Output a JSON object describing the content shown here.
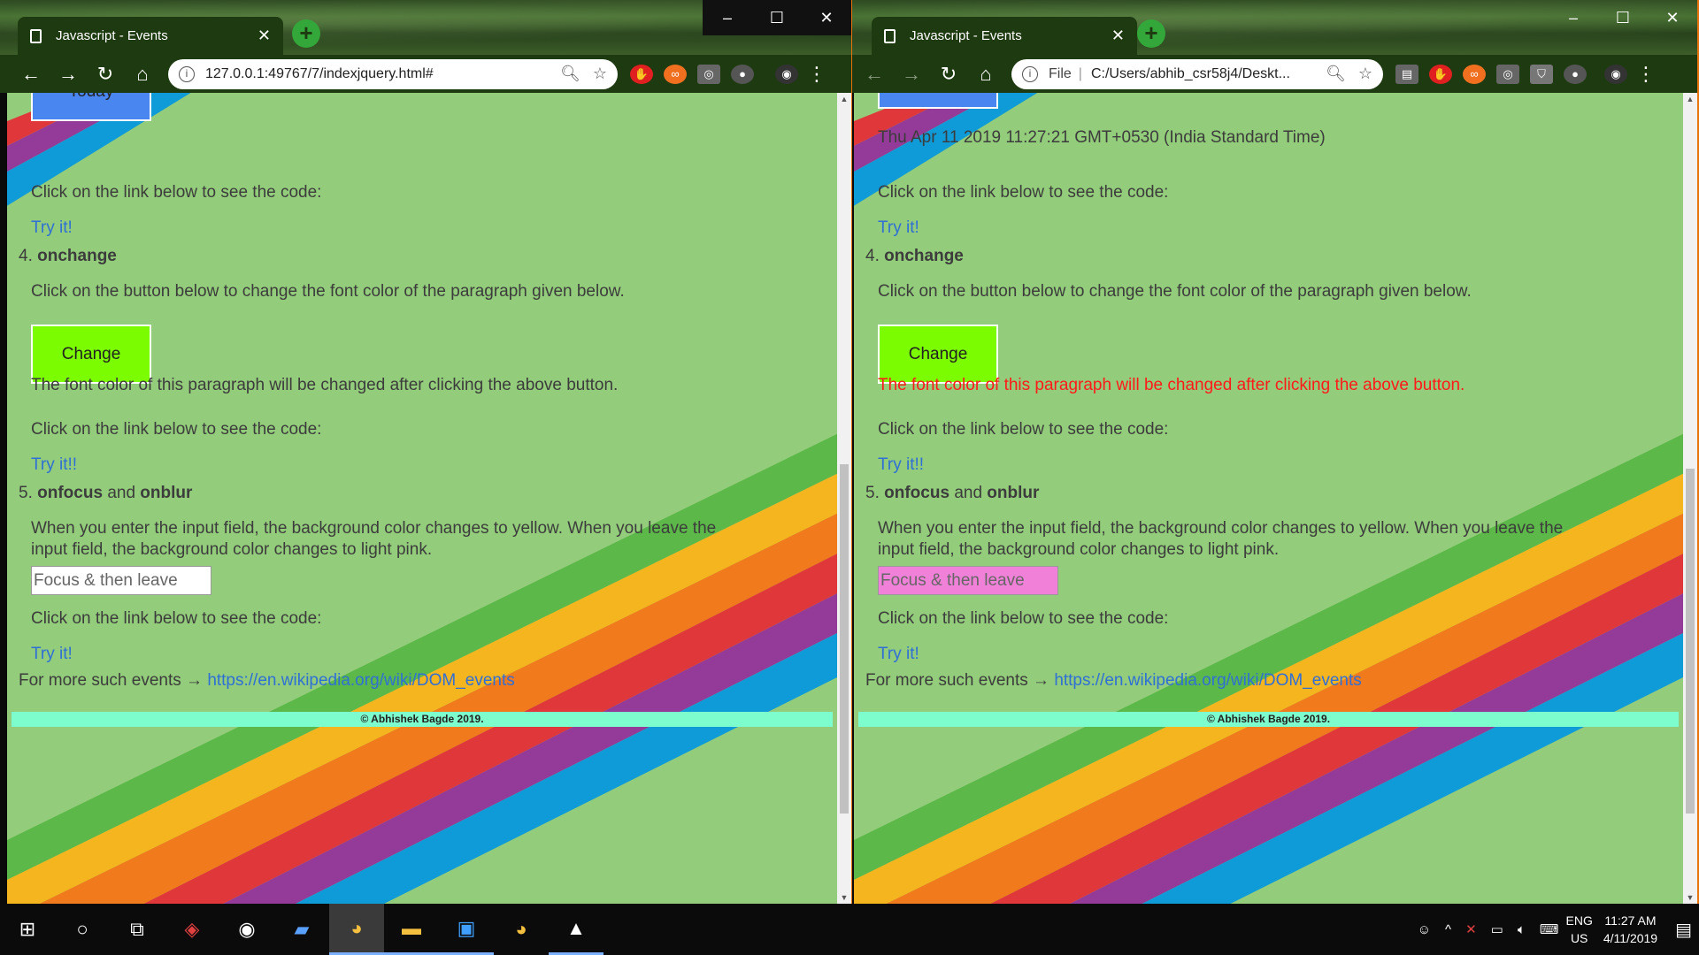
{
  "left_window": {
    "tab_title": "Javascript - Events",
    "url": "127.0.0.1:49767/7/indexjquery.html#",
    "today_button": "Today",
    "date_text": "",
    "click_link_text": "Click on the link below to see the code:",
    "try1": "Try it!",
    "h4_num": "4.",
    "h4_name": "onchange",
    "onchange_desc": "Click on the button below to change the font color of the paragraph given below.",
    "change_button": "Change",
    "para_text": "The font color of this paragraph will be changed after clicking the above button.",
    "para_color": "#3c3c3c",
    "click_link_text2": "Click on the link below to see the code:",
    "try2": "Try it!!",
    "h5_num": "5.",
    "h5_name1": "onfocus",
    "h5_and": "and",
    "h5_name2": "onblur",
    "focus_desc_1": "When you enter the input field, the background color changes to yellow. When you leave the",
    "focus_desc_2": "input field, the background color changes to light pink.",
    "input_value": "Focus & then leave",
    "input_bg": "#ffffff",
    "click_link_text3": "Click on the link below to see the code:",
    "try3": "Try it!",
    "more_events": "For more such events →",
    "more_link": "https://en.wikipedia.org/wiki/DOM_events",
    "footer": "© Abhishek Bagde 2019."
  },
  "right_window": {
    "tab_title": "Javascript - Events",
    "url_prefix": "File",
    "url": "C:/Users/abhib_csr58j4/Deskt...",
    "date_text": "Thu Apr 11 2019 11:27:21 GMT+0530 (India Standard Time)",
    "click_link_text": "Click on the link below to see the code:",
    "try1": "Try it!",
    "h4_num": "4.",
    "h4_name": "onchange",
    "onchange_desc": "Click on the button below to change the font color of the paragraph given below.",
    "change_button": "Change",
    "para_text": "The font color of this paragraph will be changed after clicking the above button.",
    "para_color": "#ff1a1a",
    "click_link_text2": "Click on the link below to see the code:",
    "try2": "Try it!!",
    "h5_num": "5.",
    "h5_name1": "onfocus",
    "h5_and": "and",
    "h5_name2": "onblur",
    "focus_desc_1": "When you enter the input field, the background color changes to yellow. When you leave the",
    "focus_desc_2": "input field, the background color changes to light pink.",
    "input_value": "Focus & then leave",
    "input_bg": "#f080d8",
    "click_link_text3": "Click on the link below to see the code:",
    "try3": "Try it!",
    "more_events": "For more such events →",
    "more_link": "https://en.wikipedia.org/wiki/DOM_events",
    "footer": "© Abhishek Bagde 2019."
  },
  "colors": {
    "page_bg": "#93cd7b",
    "link": "#2f6fd6",
    "today_button": "#4a86f0",
    "change_button": "#7cfc00",
    "footer_bg": "#7dfccd",
    "stripe_green": "#5cb848",
    "stripe_yellow": "#f5b51f",
    "stripe_orange": "#f07a1c",
    "stripe_red": "#e0383a",
    "stripe_purple": "#943a98",
    "stripe_blue": "#0f9ad8"
  },
  "taskbar": {
    "lang_1": "ENG",
    "lang_2": "US",
    "time": "11:27 AM",
    "date": "4/11/2019"
  }
}
